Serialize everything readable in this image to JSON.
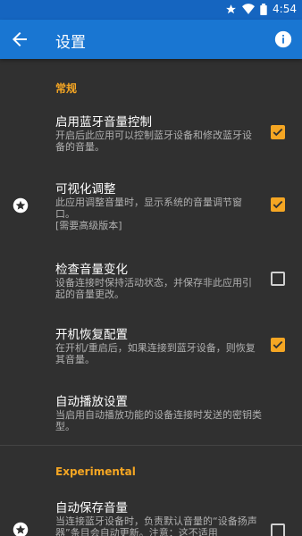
{
  "status": {
    "time": "4:54",
    "icons": [
      "star-icon",
      "wifi-icon",
      "battery-icon"
    ]
  },
  "appbar": {
    "title": "设置",
    "back_icon": "back-arrow-icon",
    "info_icon": "info-icon",
    "color": "#1976d2"
  },
  "sections": {
    "general": {
      "label": "常规",
      "items": [
        {
          "title": "启用蓝牙音量控制",
          "summary": "开启后此应用可以控制蓝牙设备和修改蓝牙设备的音量。",
          "checked": true
        },
        {
          "title": "可视化调整",
          "summary": "此应用调整音量时，显示系统的音量调节窗口。",
          "extra": "[需要高级版本]",
          "checked": true,
          "badge": "star-icon"
        },
        {
          "title": "检查音量变化",
          "summary": "设备连接时保持活动状态，并保存非此应用引起的音量更改。",
          "checked": false
        },
        {
          "title": "开机恢复配置",
          "summary": "在开机/重启后，如果连接到蓝牙设备，则恢复其音量。",
          "checked": true
        },
        {
          "title": "自动播放设置",
          "summary": "当启用自动播放功能的设备连接时发送的密钥类型。"
        }
      ]
    },
    "experimental": {
      "label": "Experimental",
      "items": [
        {
          "title": "自动保存音量",
          "summary": "当连接蓝牙设备时，负责默认音量的“设备扬声器”条目会自动更新。注意：这不适用",
          "checked": false,
          "badge": "star-icon"
        }
      ]
    }
  },
  "accent_color": "#f5a623"
}
